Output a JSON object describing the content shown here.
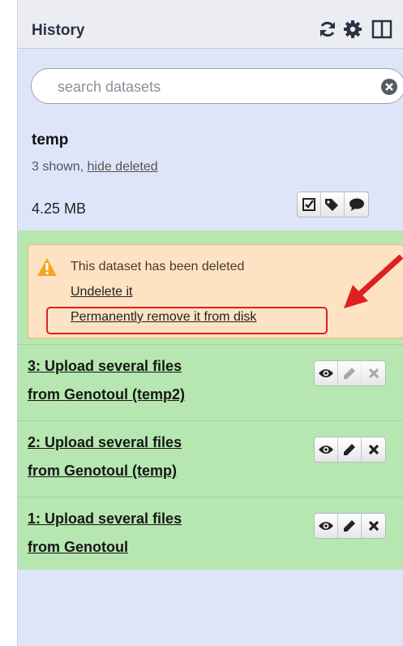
{
  "header": {
    "title": "History",
    "icons": [
      "refresh-icon",
      "gear-icon",
      "columns-icon"
    ]
  },
  "search": {
    "placeholder": "search datasets",
    "value": ""
  },
  "history": {
    "name": "temp",
    "count_text": "3 shown, ",
    "hide_deleted_label": "hide deleted",
    "size": "4.25 MB",
    "action_icons": [
      "check-square-icon",
      "tags-icon",
      "comment-icon"
    ]
  },
  "deleted_notice": {
    "message": "This dataset has been deleted",
    "undelete_label": "Undelete it",
    "purge_label": "Permanently remove it from disk"
  },
  "datasets": [
    {
      "hid": 3,
      "title_line1": "3: Upload several files",
      "title_line2": "from Genotoul (temp2)",
      "deleted": true
    },
    {
      "hid": 2,
      "title_line1": "2: Upload several files",
      "title_line2": "from Genotoul (temp)",
      "deleted": false
    },
    {
      "hid": 1,
      "title_line1": "1: Upload several files",
      "title_line2": "from Genotoul",
      "deleted": false
    }
  ],
  "colors": {
    "panel_bg": "#dfe5f9",
    "dataset_ok_bg": "#b7e7b0",
    "warning_bg": "#fde3c3",
    "annotation_red": "#e02020"
  }
}
